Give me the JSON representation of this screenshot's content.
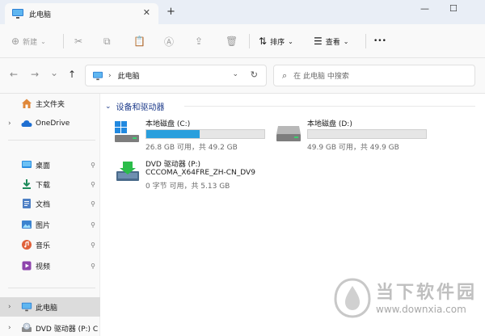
{
  "tab": {
    "title": "此电脑",
    "close": "✕"
  },
  "newtab": "+",
  "window": {
    "minimize": "—",
    "maximize": "☐",
    "close": "✕"
  },
  "toolbar": {
    "new_label": "新建",
    "sort_label": "排序",
    "view_label": "查看",
    "more_label": "•••"
  },
  "nav": {
    "back": "←",
    "forward": "→",
    "recent": "⌄",
    "up": "↑",
    "address_crumb": "此电脑",
    "crumb_sep": "›",
    "address_dropdown": "⌄",
    "refresh": "↻",
    "search_placeholder": "在 此电脑 中搜索"
  },
  "sidebar": {
    "items": [
      {
        "label": "主文件夹"
      },
      {
        "label": "OneDrive"
      },
      {
        "label": "桌面",
        "pin": "📌"
      },
      {
        "label": "下载",
        "pin": "📌"
      },
      {
        "label": "文档",
        "pin": "📌"
      },
      {
        "label": "图片",
        "pin": "📌"
      },
      {
        "label": "音乐",
        "pin": "📌"
      },
      {
        "label": "视频",
        "pin": "📌"
      },
      {
        "label": "此电脑"
      },
      {
        "label": "DVD 驱动器 (P:) C"
      }
    ]
  },
  "content": {
    "group_title": "设备和驱动器",
    "drives": [
      {
        "name": "本地磁盘 (C:)",
        "info": "26.8 GB 可用，共 49.2 GB",
        "used_fraction": 0.455,
        "bar_color": "#2a9fdd"
      },
      {
        "name": "本地磁盘 (D:)",
        "info": "49.9 GB 可用，共 49.9 GB",
        "used_fraction": 0.0,
        "bar_color": "#2a9fdd"
      }
    ],
    "dvd": {
      "name": "DVD 驱动器 (P:)",
      "label": "CCCOMA_X64FRE_ZH-CN_DV9",
      "info": "0 字节 可用，共 5.13 GB"
    }
  },
  "watermark": {
    "text": "当下软件园",
    "url": "www.downxia.com"
  }
}
